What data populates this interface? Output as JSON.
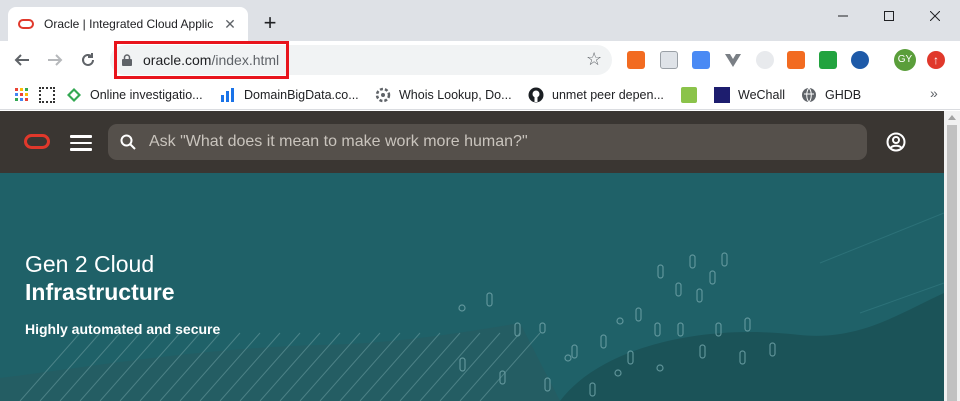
{
  "tab": {
    "title": "Oracle | Integrated Cloud Applic",
    "close_glyph": "✕",
    "new_tab_glyph": "+"
  },
  "address": {
    "host": "oracle.com",
    "path": "/index.html"
  },
  "profile": {
    "initials": "GY"
  },
  "bookmarks": [
    {
      "label": "",
      "icon": "apps-icon"
    },
    {
      "label": "",
      "icon": "qr-icon"
    },
    {
      "label": "Online investigatio...",
      "icon": "online-investigation-icon"
    },
    {
      "label": "DomainBigData.co...",
      "icon": "domainbigdata-icon"
    },
    {
      "label": "Whois Lookup, Do...",
      "icon": "whois-icon"
    },
    {
      "label": "unmet peer depen...",
      "icon": "github-icon"
    },
    {
      "label": "",
      "icon": "green-bookmark-icon"
    },
    {
      "label": "WeChall",
      "icon": "wechall-icon"
    },
    {
      "label": "GHDB",
      "icon": "ghdb-icon"
    }
  ],
  "more_bookmarks": "»",
  "search": {
    "placeholder": "Ask \"What does it mean to make work more human?\""
  },
  "hero": {
    "line1": "Gen 2 Cloud",
    "line2": "Infrastructure",
    "subtitle": "Highly automated and secure"
  },
  "colors": {
    "oracle_red": "#e0382b",
    "header_bg": "#3a3632",
    "hero_teal": "#1f6168",
    "highlight_red": "#e8141c"
  }
}
